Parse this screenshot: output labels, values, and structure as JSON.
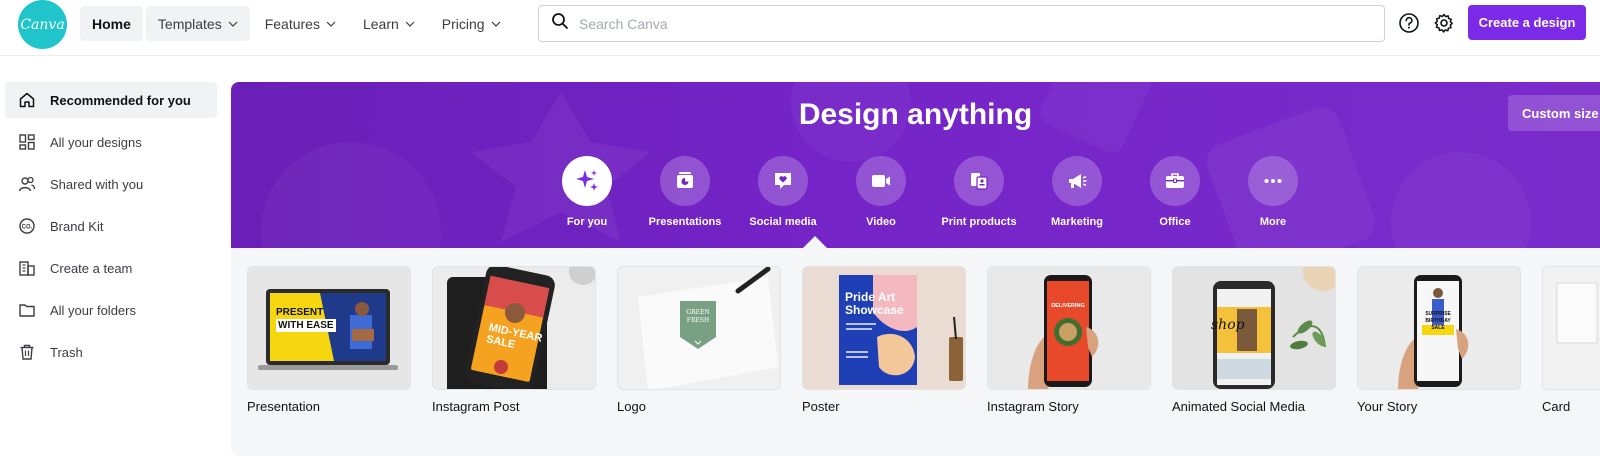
{
  "logo": {
    "text": "Canva"
  },
  "nav": [
    {
      "label": "Home"
    },
    {
      "label": "Templates"
    },
    {
      "label": "Features"
    },
    {
      "label": "Learn"
    },
    {
      "label": "Pricing"
    }
  ],
  "search": {
    "placeholder": "Search Canva"
  },
  "create_button": {
    "label": "Create a design"
  },
  "sidebar": {
    "items": [
      {
        "label": "Recommended for you",
        "icon": "home-icon"
      },
      {
        "label": "All your designs",
        "icon": "grid-icon"
      },
      {
        "label": "Shared with you",
        "icon": "users-icon"
      },
      {
        "label": "Brand Kit",
        "icon": "brand-kit-icon"
      },
      {
        "label": "Create a team",
        "icon": "building-icon"
      },
      {
        "label": "All your folders",
        "icon": "folder-icon"
      },
      {
        "label": "Trash",
        "icon": "trash-icon"
      }
    ]
  },
  "hero": {
    "title": "Design anything",
    "custom_size": "Custom size",
    "categories": [
      {
        "label": "For you",
        "icon": "sparkle-icon"
      },
      {
        "label": "Presentations",
        "icon": "presentation-icon"
      },
      {
        "label": "Social media",
        "icon": "heart-chat-icon"
      },
      {
        "label": "Video",
        "icon": "video-camera-icon"
      },
      {
        "label": "Print products",
        "icon": "print-icon"
      },
      {
        "label": "Marketing",
        "icon": "megaphone-icon"
      },
      {
        "label": "Office",
        "icon": "briefcase-icon"
      },
      {
        "label": "More",
        "icon": "more-icon"
      }
    ]
  },
  "cards": [
    {
      "label": "Presentation",
      "thumb_text": [
        "PRESENT",
        "WITH EASE"
      ]
    },
    {
      "label": "Instagram Post",
      "thumb_text": [
        "MID-YEAR",
        "SALE"
      ]
    },
    {
      "label": "Logo",
      "thumb_text": [
        "GREEN",
        "FRESH"
      ]
    },
    {
      "label": "Poster",
      "thumb_text": [
        "Pride Art",
        "Showcase"
      ]
    },
    {
      "label": "Instagram Story",
      "thumb_text": [
        "DELIVERING"
      ]
    },
    {
      "label": "Animated Social Media",
      "thumb_text": [
        "shop"
      ]
    },
    {
      "label": "Your Story",
      "thumb_text": [
        "SURPRISE",
        "BIRTHDAY",
        "SALE"
      ]
    },
    {
      "label": "Card"
    }
  ],
  "colors": {
    "brand_purple": "#7d2ae8",
    "hero_purple": "#7524c8",
    "logo_teal": "#20c4cb"
  }
}
